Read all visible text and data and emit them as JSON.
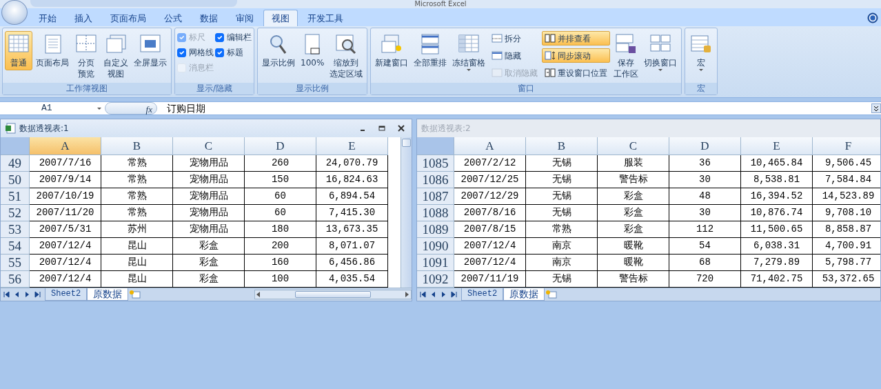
{
  "window": {
    "title": "Microsoft Excel"
  },
  "tabs": [
    {
      "label": "开始",
      "selected": false
    },
    {
      "label": "插入",
      "selected": false
    },
    {
      "label": "页面布局",
      "selected": false
    },
    {
      "label": "公式",
      "selected": false
    },
    {
      "label": "数据",
      "selected": false
    },
    {
      "label": "审阅",
      "selected": false
    },
    {
      "label": "视图",
      "selected": true
    },
    {
      "label": "开发工具",
      "selected": false
    }
  ],
  "ribbon": {
    "groups": [
      {
        "title": "工作簿视图",
        "columns": [
          [
            {
              "kind": "large",
              "label": "普通",
              "selected": true,
              "dropdown": false
            }
          ],
          [
            {
              "kind": "large",
              "label": "页面布局",
              "selected": false,
              "dropdown": false
            }
          ],
          [
            {
              "kind": "large",
              "lines": [
                "分页",
                "预览"
              ],
              "selected": false,
              "dropdown": false
            }
          ],
          [
            {
              "kind": "large",
              "lines": [
                "自定义",
                "视图"
              ],
              "selected": false,
              "dropdown": false
            }
          ],
          [
            {
              "kind": "large",
              "label": "全屏显示",
              "selected": false,
              "dropdown": false
            }
          ]
        ]
      },
      {
        "title": "显示/隐藏",
        "columns": [
          [
            {
              "kind": "check",
              "label": "标尺",
              "checked": true,
              "disabled": true
            },
            {
              "kind": "check",
              "label": "网格线",
              "checked": true,
              "disabled": false
            },
            {
              "kind": "check",
              "label": "消息栏",
              "checked": false,
              "disabled": true
            }
          ],
          [
            {
              "kind": "check",
              "label": "编辑栏",
              "checked": true,
              "disabled": false
            },
            {
              "kind": "check",
              "label": "标题",
              "checked": true,
              "disabled": false
            }
          ]
        ]
      },
      {
        "title": "显示比例",
        "columns": [
          [
            {
              "kind": "large",
              "label": "显示比例",
              "selected": false,
              "dropdown": false
            }
          ],
          [
            {
              "kind": "large",
              "label": "100%",
              "selected": false,
              "dropdown": false
            }
          ],
          [
            {
              "kind": "large",
              "lines": [
                "缩放到",
                "选定区域"
              ],
              "selected": false,
              "dropdown": false
            }
          ]
        ]
      },
      {
        "title": "窗口",
        "columns": [
          [
            {
              "kind": "large",
              "label": "新建窗口",
              "selected": false,
              "dropdown": false
            }
          ],
          [
            {
              "kind": "large",
              "label": "全部重排",
              "selected": false,
              "dropdown": false
            }
          ],
          [
            {
              "kind": "large",
              "label": "冻结窗格",
              "selected": false,
              "dropdown": true
            }
          ],
          [
            {
              "kind": "small",
              "label": "拆分",
              "selected": false,
              "disabled": false
            },
            {
              "kind": "small",
              "label": "隐藏",
              "selected": false,
              "disabled": false
            },
            {
              "kind": "small",
              "label": "取消隐藏",
              "selected": false,
              "disabled": true
            }
          ],
          [
            {
              "kind": "small",
              "label": "并排查看",
              "selected": true,
              "disabled": false
            },
            {
              "kind": "small",
              "label": "同步滚动",
              "selected": true,
              "disabled": false
            },
            {
              "kind": "small",
              "label": "重设窗口位置",
              "selected": false,
              "disabled": false
            }
          ],
          [
            {
              "kind": "large",
              "lines": [
                "保存",
                "工作区"
              ],
              "selected": false,
              "dropdown": false
            }
          ],
          [
            {
              "kind": "large",
              "label": "切换窗口",
              "selected": false,
              "dropdown": true
            }
          ]
        ]
      },
      {
        "title": "宏",
        "columns": [
          [
            {
              "kind": "large",
              "label": "宏",
              "selected": false,
              "dropdown": true
            }
          ]
        ]
      }
    ]
  },
  "formula_bar": {
    "name_box": "A1",
    "function_label": "fx",
    "content": "订购日期"
  },
  "workbooks": [
    {
      "title": "数据透视表:1",
      "active": true,
      "columns": [
        {
          "label": "A",
          "selected": true
        },
        {
          "label": "B",
          "selected": false
        },
        {
          "label": "C",
          "selected": false
        },
        {
          "label": "D",
          "selected": false
        },
        {
          "label": "E",
          "selected": false
        }
      ],
      "rows": [
        {
          "header": "49",
          "cells": [
            "2007/7/16",
            "常熟",
            "宠物用品",
            "260",
            "24,070.79"
          ]
        },
        {
          "header": "50",
          "cells": [
            "2007/9/14",
            "常熟",
            "宠物用品",
            "150",
            "16,824.63"
          ]
        },
        {
          "header": "51",
          "cells": [
            "2007/10/19",
            "常熟",
            "宠物用品",
            "60",
            "6,894.54"
          ]
        },
        {
          "header": "52",
          "cells": [
            "2007/11/20",
            "常熟",
            "宠物用品",
            "60",
            "7,415.30"
          ]
        },
        {
          "header": "53",
          "cells": [
            "2007/5/31",
            "苏州",
            "宠物用品",
            "180",
            "13,673.35"
          ]
        },
        {
          "header": "54",
          "cells": [
            "2007/12/4",
            "昆山",
            "彩盒",
            "200",
            "8,071.07"
          ]
        },
        {
          "header": "55",
          "cells": [
            "2007/12/4",
            "昆山",
            "彩盒",
            "160",
            "6,456.86"
          ]
        },
        {
          "header": "56",
          "cells": [
            "2007/12/4",
            "昆山",
            "彩盒",
            "100",
            "4,035.54"
          ]
        }
      ],
      "sheet_tabs": [
        {
          "label": "Sheet2",
          "selected": false
        },
        {
          "label": "原数据",
          "selected": true
        }
      ]
    },
    {
      "title": "数据透视表:2",
      "active": false,
      "columns": [
        {
          "label": "A",
          "selected": false
        },
        {
          "label": "B",
          "selected": false
        },
        {
          "label": "C",
          "selected": false
        },
        {
          "label": "D",
          "selected": false
        },
        {
          "label": "E",
          "selected": false
        },
        {
          "label": "F",
          "selected": false
        }
      ],
      "rows": [
        {
          "header": "1085",
          "cells": [
            "2007/2/12",
            "无锡",
            "服装",
            "36",
            "10,465.84",
            "9,506.45"
          ]
        },
        {
          "header": "1086",
          "cells": [
            "2007/12/25",
            "无锡",
            "警告标",
            "30",
            "8,538.81",
            "7,584.84"
          ]
        },
        {
          "header": "1087",
          "cells": [
            "2007/12/29",
            "无锡",
            "彩盒",
            "48",
            "16,394.52",
            "14,523.89"
          ]
        },
        {
          "header": "1088",
          "cells": [
            "2007/8/16",
            "无锡",
            "彩盒",
            "30",
            "10,876.74",
            "9,708.10"
          ]
        },
        {
          "header": "1089",
          "cells": [
            "2007/8/15",
            "常熟",
            "彩盒",
            "112",
            "11,500.65",
            "8,858.87"
          ]
        },
        {
          "header": "1090",
          "cells": [
            "2007/12/4",
            "南京",
            "暖靴",
            "54",
            "6,038.31",
            "4,700.91"
          ]
        },
        {
          "header": "1091",
          "cells": [
            "2007/12/4",
            "南京",
            "暖靴",
            "68",
            "7,279.89",
            "5,798.77"
          ]
        },
        {
          "header": "1092",
          "cells": [
            "2007/11/19",
            "无锡",
            "警告标",
            "720",
            "71,402.75",
            "53,372.65"
          ]
        }
      ],
      "sheet_tabs": [
        {
          "label": "Sheet2",
          "selected": false
        },
        {
          "label": "原数据",
          "selected": true
        }
      ]
    }
  ]
}
